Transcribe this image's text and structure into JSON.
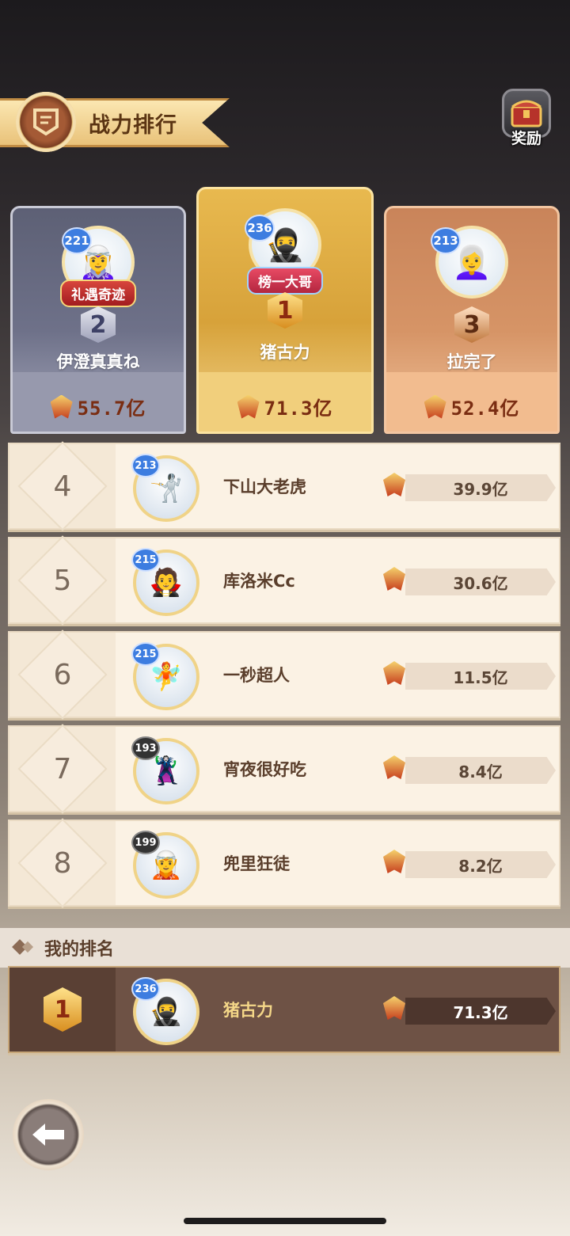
{
  "header": {
    "title": "战力排行",
    "reward_label": "奖励"
  },
  "podium": [
    {
      "rank": "2",
      "level": "221",
      "title_tag": "礼遇奇迹",
      "name": "伊澄真真ね",
      "power": "55.7亿"
    },
    {
      "rank": "1",
      "level": "236",
      "title_tag": "榜一大哥",
      "name": "猪古力",
      "power": "71.3亿"
    },
    {
      "rank": "3",
      "level": "213",
      "name": "拉完了",
      "power": "52.4亿"
    }
  ],
  "list": [
    {
      "rank": "4",
      "level": "213",
      "name": "下山大老虎",
      "power": "39.9亿"
    },
    {
      "rank": "5",
      "level": "215",
      "name": "库洛米Cc",
      "power": "30.6亿"
    },
    {
      "rank": "6",
      "level": "215",
      "name": "一秒超人",
      "power": "11.5亿"
    },
    {
      "rank": "7",
      "level": "193",
      "name": "宵夜很好吃",
      "power": "8.4亿"
    },
    {
      "rank": "8",
      "level": "199",
      "name": "兜里狂徒",
      "power": "8.2亿"
    }
  ],
  "my_rank": {
    "section_title": "我的排名",
    "rank": "1",
    "level": "236",
    "name": "猪古力",
    "power": "71.3亿"
  },
  "icons": {
    "back": "back-arrow-icon",
    "reward": "treasure-chest-icon",
    "power": "power-crest-icon"
  }
}
